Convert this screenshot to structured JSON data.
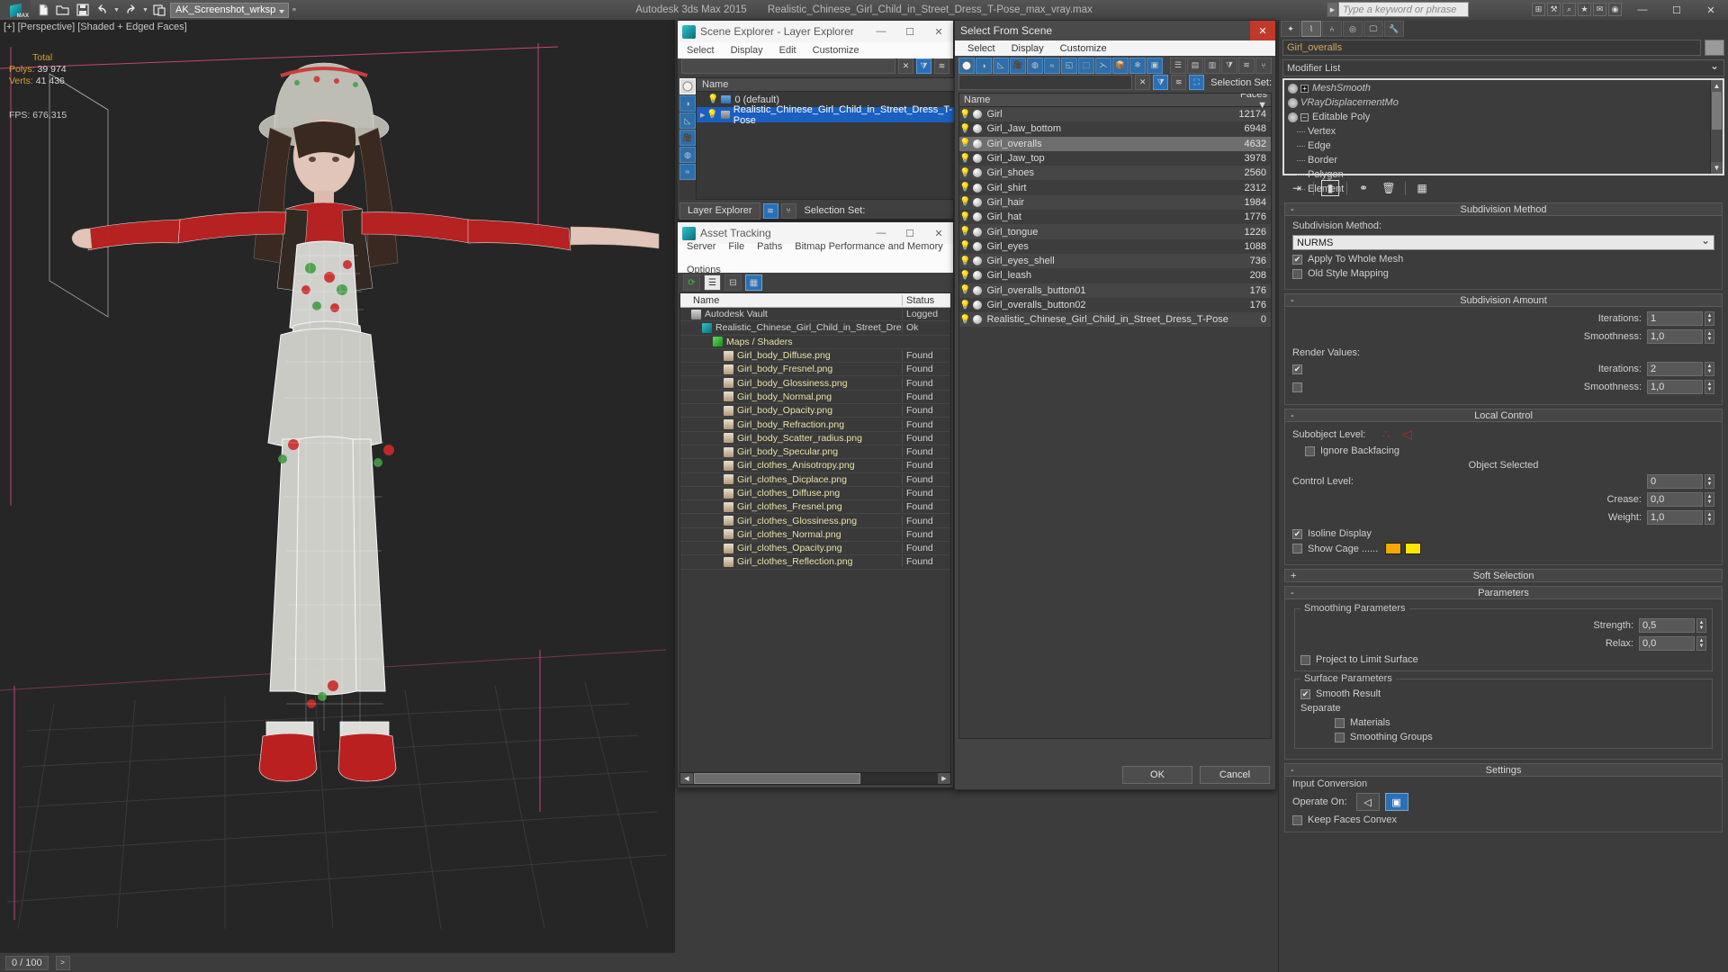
{
  "titlebar": {
    "workspace": "AK_Screenshot_wrksp",
    "app_name": "Autodesk 3ds Max  2015",
    "file_name": "Realistic_Chinese_Girl_Child_in_Street_Dress_T-Pose_max_vray.max",
    "search_placeholder": "Type a keyword or phrase",
    "quick_icons": [
      "new-icon",
      "open-icon",
      "save-icon",
      "undo-icon",
      "redo-icon",
      "set-project-icon"
    ],
    "window_controls": {
      "minimize": "—",
      "maximize": "☐",
      "close": "✕"
    }
  },
  "viewport": {
    "label": "[+] [Perspective] [Shaded + Edged Faces]",
    "stats": {
      "total_label": "Total",
      "polys_label": "Polys:",
      "polys_value": "39 974",
      "verts_label": "Verts:",
      "verts_value": "41 436",
      "fps_label": "FPS:",
      "fps_value": "676,315"
    }
  },
  "scene_explorer": {
    "title": "Scene Explorer - Layer Explorer",
    "menus": [
      "Select",
      "Display",
      "Edit",
      "Customize"
    ],
    "column_header": "Name",
    "rows": [
      {
        "label": "0 (default)",
        "selected": false,
        "expandable": false,
        "gray_layer": false
      },
      {
        "label": "Realistic_Chinese_Girl_Child_in_Street_Dress_T-Pose",
        "selected": true,
        "expandable": true,
        "gray_layer": true
      }
    ],
    "footer_tab": "Layer Explorer",
    "selection_set_label": "Selection Set:"
  },
  "asset_tracking": {
    "title": "Asset Tracking",
    "menus": [
      "Server",
      "File",
      "Paths",
      "Bitmap Performance and Memory",
      "Options"
    ],
    "columns": [
      "Name",
      "Status"
    ],
    "rows": [
      {
        "name": "Autodesk Vault",
        "status": "Logged",
        "indent": 1,
        "icon": "vault-icon"
      },
      {
        "name": "Realistic_Chinese_Girl_Child_in_Street_Dress_T-P...",
        "status": "Ok",
        "indent": 2,
        "icon": "max-file-icon"
      },
      {
        "name": "Maps / Shaders",
        "status": "",
        "indent": 3,
        "icon": "maps-icon"
      },
      {
        "name": "Girl_body_Diffuse.png",
        "status": "Found",
        "indent": 4,
        "icon": "png-icon"
      },
      {
        "name": "Girl_body_Fresnel.png",
        "status": "Found",
        "indent": 4,
        "icon": "png-icon"
      },
      {
        "name": "Girl_body_Glossiness.png",
        "status": "Found",
        "indent": 4,
        "icon": "png-icon"
      },
      {
        "name": "Girl_body_Normal.png",
        "status": "Found",
        "indent": 4,
        "icon": "png-icon"
      },
      {
        "name": "Girl_body_Opacity.png",
        "status": "Found",
        "indent": 4,
        "icon": "png-icon"
      },
      {
        "name": "Girl_body_Refraction.png",
        "status": "Found",
        "indent": 4,
        "icon": "png-icon"
      },
      {
        "name": "Girl_body_Scatter_radius.png",
        "status": "Found",
        "indent": 4,
        "icon": "png-icon"
      },
      {
        "name": "Girl_body_Specular.png",
        "status": "Found",
        "indent": 4,
        "icon": "png-icon"
      },
      {
        "name": "Girl_clothes_Anisotropy.png",
        "status": "Found",
        "indent": 4,
        "icon": "png-icon"
      },
      {
        "name": "Girl_clothes_Dicplace.png",
        "status": "Found",
        "indent": 4,
        "icon": "png-icon"
      },
      {
        "name": "Girl_clothes_Diffuse.png",
        "status": "Found",
        "indent": 4,
        "icon": "png-icon"
      },
      {
        "name": "Girl_clothes_Fresnel.png",
        "status": "Found",
        "indent": 4,
        "icon": "png-icon"
      },
      {
        "name": "Girl_clothes_Glossiness.png",
        "status": "Found",
        "indent": 4,
        "icon": "png-icon"
      },
      {
        "name": "Girl_clothes_Normal.png",
        "status": "Found",
        "indent": 4,
        "icon": "png-icon"
      },
      {
        "name": "Girl_clothes_Opacity.png",
        "status": "Found",
        "indent": 4,
        "icon": "png-icon"
      },
      {
        "name": "Girl_clothes_Reflection.png",
        "status": "Found",
        "indent": 4,
        "icon": "png-icon"
      }
    ]
  },
  "select_from_scene": {
    "title": "Select From Scene",
    "menus": [
      "Select",
      "Display",
      "Customize"
    ],
    "selection_set_label": "Selection Set:",
    "columns": [
      "Name",
      "Faces"
    ],
    "rows": [
      {
        "name": "Girl",
        "faces": "12174",
        "selected": false
      },
      {
        "name": "Girl_Jaw_bottom",
        "faces": "6948",
        "selected": false
      },
      {
        "name": "Girl_overalls",
        "faces": "4632",
        "selected": true
      },
      {
        "name": "Girl_Jaw_top",
        "faces": "3978",
        "selected": false
      },
      {
        "name": "Girl_shoes",
        "faces": "2560",
        "selected": false
      },
      {
        "name": "Girl_shirt",
        "faces": "2312",
        "selected": false
      },
      {
        "name": "Girl_hair",
        "faces": "1984",
        "selected": false
      },
      {
        "name": "Girl_hat",
        "faces": "1776",
        "selected": false
      },
      {
        "name": "Girl_tongue",
        "faces": "1226",
        "selected": false
      },
      {
        "name": "Girl_eyes",
        "faces": "1088",
        "selected": false
      },
      {
        "name": "Girl_eyes_shell",
        "faces": "736",
        "selected": false
      },
      {
        "name": "Girl_leash",
        "faces": "208",
        "selected": false
      },
      {
        "name": "Girl_overalls_button01",
        "faces": "176",
        "selected": false
      },
      {
        "name": "Girl_overalls_button02",
        "faces": "176",
        "selected": false
      },
      {
        "name": "Realistic_Chinese_Girl_Child_in_Street_Dress_T-Pose",
        "faces": "0",
        "selected": false
      }
    ],
    "buttons": {
      "ok": "OK",
      "cancel": "Cancel"
    }
  },
  "command_panel": {
    "object_name": "Girl_overalls",
    "modifier_list_label": "Modifier List",
    "stack": [
      {
        "label": "MeshSmooth",
        "italic": true,
        "has_plus": true,
        "has_minus": false,
        "sub": false
      },
      {
        "label": "VRayDisplacementMo",
        "italic": true,
        "has_plus": false,
        "has_minus": false,
        "sub": false
      },
      {
        "label": "Editable Poly",
        "italic": false,
        "has_plus": false,
        "has_minus": true,
        "sub": false
      },
      {
        "label": "Vertex",
        "italic": false,
        "has_plus": false,
        "has_minus": false,
        "sub": true
      },
      {
        "label": "Edge",
        "italic": false,
        "has_plus": false,
        "has_minus": false,
        "sub": true
      },
      {
        "label": "Border",
        "italic": false,
        "has_plus": false,
        "has_minus": false,
        "sub": true
      },
      {
        "label": "Polygon",
        "italic": false,
        "has_plus": false,
        "has_minus": false,
        "sub": true
      },
      {
        "label": "Element",
        "italic": false,
        "has_plus": false,
        "has_minus": false,
        "sub": true
      }
    ],
    "rollouts": {
      "subdivision_method": {
        "title": "Subdivision Method",
        "state": "-",
        "method_label": "Subdivision Method:",
        "method_value": "NURMS",
        "apply_whole_mesh_label": "Apply To Whole Mesh",
        "apply_whole_mesh_checked": true,
        "old_style_mapping_label": "Old Style Mapping",
        "old_style_mapping_checked": false
      },
      "subdivision_amount": {
        "title": "Subdivision Amount",
        "state": "-",
        "iterations_label": "Iterations:",
        "iterations_value": "1",
        "smoothness_label": "Smoothness:",
        "smoothness_value": "1,0",
        "render_values_label": "Render Values:",
        "render_iterations_label": "Iterations:",
        "render_iterations_value": "2",
        "render_iterations_checked": true,
        "render_smoothness_label": "Smoothness:",
        "render_smoothness_value": "1,0",
        "render_smoothness_checked": false
      },
      "local_control": {
        "title": "Local Control",
        "state": "-",
        "subobject_level_label": "Subobject Level:",
        "ignore_backfacing_label": "Ignore Backfacing",
        "ignore_backfacing_checked": false,
        "object_selected_label": "Object Selected",
        "control_level_label": "Control Level:",
        "control_level_value": "0",
        "crease_label": "Crease:",
        "crease_value": "0,0",
        "weight_label": "Weight:",
        "weight_value": "1,0",
        "isoline_display_label": "Isoline Display",
        "isoline_display_checked": true,
        "show_cage_label": "Show Cage ......",
        "show_cage_checked": false,
        "cage_color_1": "#f5a800",
        "cage_color_2": "#ffe500"
      },
      "soft_selection": {
        "title": "Soft Selection",
        "state": "+"
      },
      "parameters": {
        "title": "Parameters",
        "state": "-",
        "smoothing_group_label": "Smoothing Parameters",
        "strength_label": "Strength:",
        "strength_value": "0,5",
        "relax_label": "Relax:",
        "relax_value": "0,0",
        "project_limit_label": "Project to Limit Surface",
        "project_limit_checked": false,
        "surface_group_label": "Surface Parameters",
        "smooth_result_label": "Smooth Result",
        "smooth_result_checked": true,
        "separate_label": "Separate",
        "materials_label": "Materials",
        "materials_checked": false,
        "smoothing_groups_label": "Smoothing Groups",
        "smoothing_groups_checked": false
      },
      "settings": {
        "title": "Settings",
        "state": "-",
        "input_conversion_label": "Input Conversion",
        "operate_on_label": "Operate On:",
        "keep_faces_convex_label": "Keep Faces Convex",
        "keep_faces_convex_checked": false
      }
    }
  },
  "status_bar": {
    "frame_field": "0 / 100",
    "next_btn": ">"
  }
}
